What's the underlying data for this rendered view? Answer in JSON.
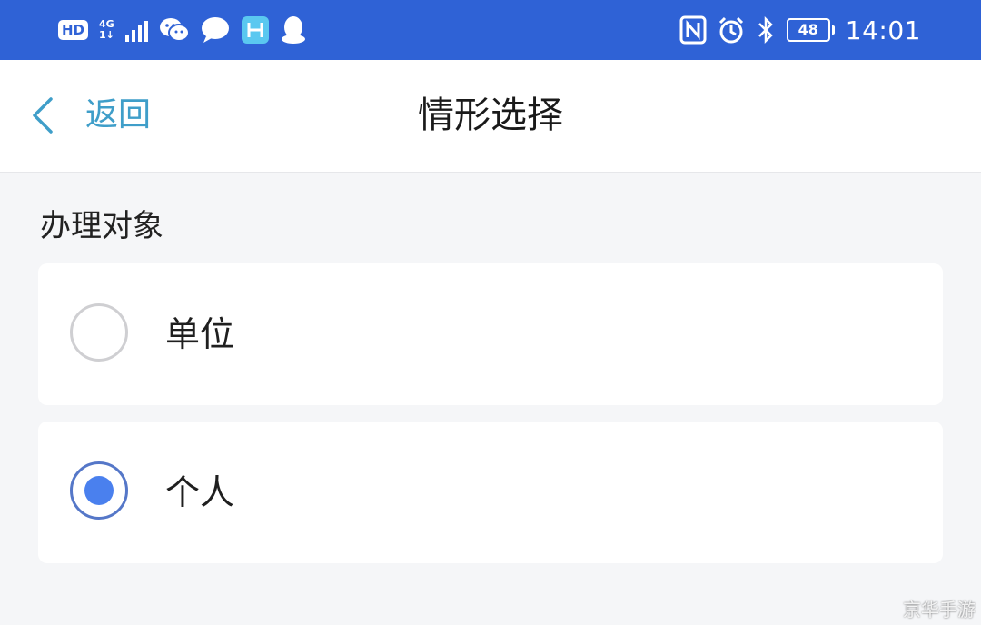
{
  "status_bar": {
    "hd": "HD",
    "network_type": "4G",
    "network_sub": "1↓",
    "battery": "48",
    "time": "14:01",
    "icons": [
      "wechat-icon",
      "message-icon",
      "app-h-icon",
      "qq-icon",
      "nfc-icon",
      "alarm-icon",
      "bluetooth-icon"
    ]
  },
  "nav": {
    "back_label": "返回",
    "title": "情形选择"
  },
  "section": {
    "label": "办理对象"
  },
  "options": [
    {
      "label": "单位",
      "selected": false
    },
    {
      "label": "个人",
      "selected": true
    }
  ],
  "colors": {
    "status_bar": "#2f62d6",
    "back": "#3f9ec9",
    "radio_selected": "#4a80ee"
  },
  "watermark": "京华手游"
}
